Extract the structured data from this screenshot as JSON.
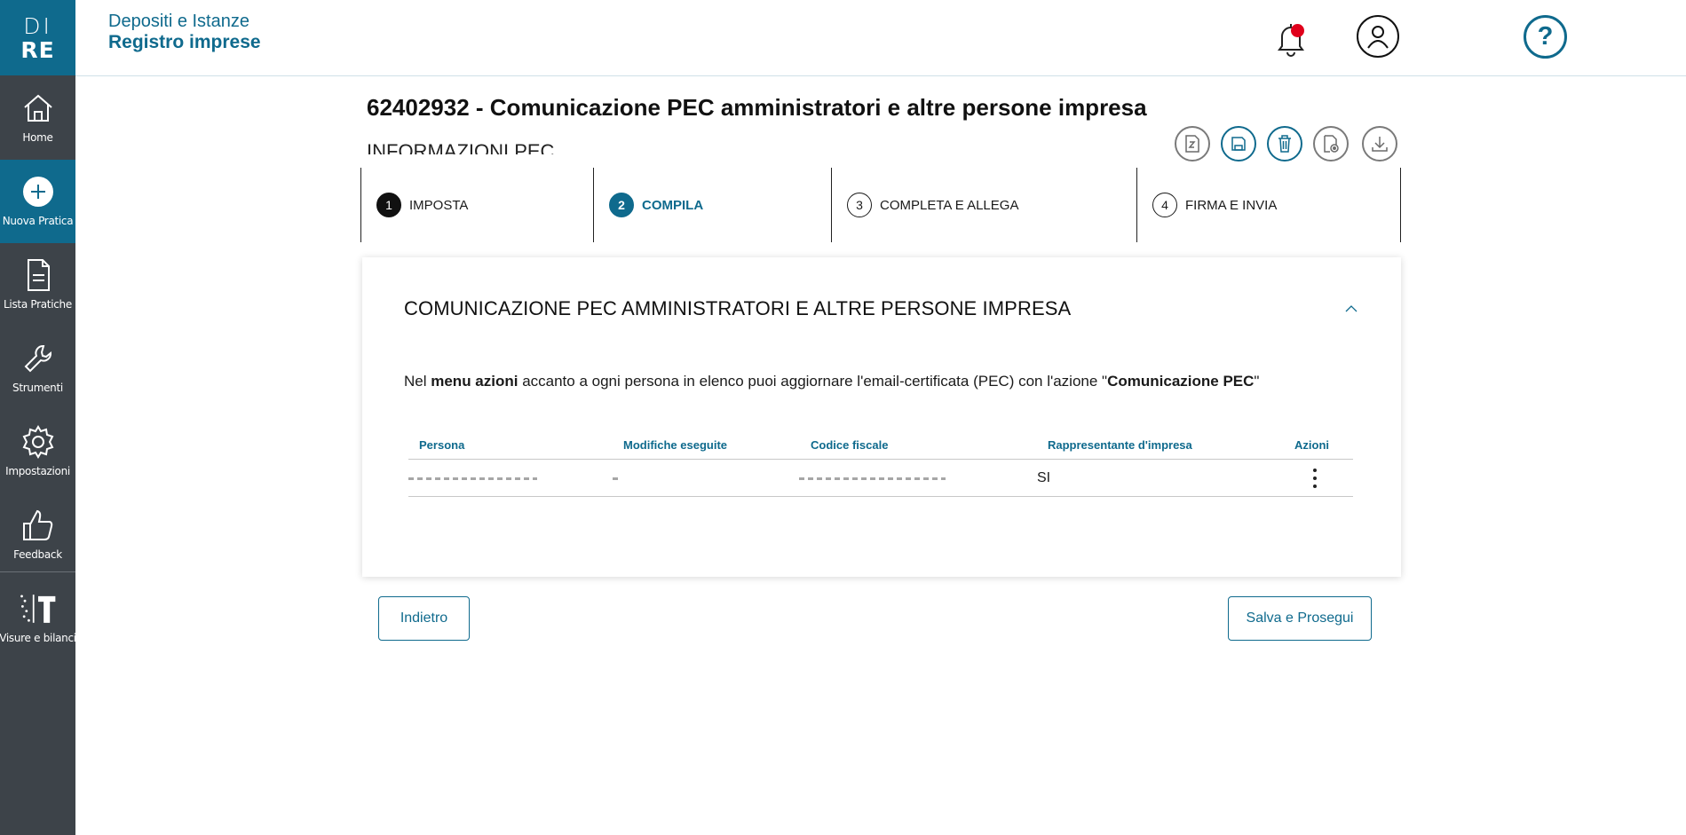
{
  "logo": {
    "line1": "DI",
    "line2": "RE"
  },
  "sidebar": {
    "items": [
      {
        "label": "Home"
      },
      {
        "label": "Nuova Pratica"
      },
      {
        "label": "Lista Pratiche"
      },
      {
        "label": "Strumenti"
      },
      {
        "label": "Impostazioni"
      },
      {
        "label": "Feedback"
      },
      {
        "label": "Visure e bilanci"
      }
    ]
  },
  "header": {
    "subtitle": "Depositi e Istanze",
    "title": "Registro imprese",
    "help": "?",
    "notification_icon": "bell-icon",
    "user_icon": "user-icon"
  },
  "page": {
    "title": "62402932 - Comunicazione PEC amministratori e altre persone impresa",
    "obscured_text": "INFORMAZIONI PEC"
  },
  "steps": [
    {
      "number": "1",
      "label": "IMPOSTA"
    },
    {
      "number": "2",
      "label": "COMPILA"
    },
    {
      "number": "3",
      "label": "COMPLETA E ALLEGA"
    },
    {
      "number": "4",
      "label": "FIRMA E INVIA"
    }
  ],
  "card": {
    "title": "COMUNICAZIONE PEC AMMINISTRATORI E ALTRE PERSONE IMPRESA",
    "intro_prefix": "Nel ",
    "intro_bold": "menu azioni",
    "intro_middle": " accanto a ogni persona in elenco puoi aggiornare l'email-certificata (PEC) con l'azione \"",
    "intro_bold2": "Comunicazione PEC",
    "intro_suffix": "\""
  },
  "table": {
    "columns": [
      "Persona",
      "Modifiche eseguite",
      "Codice fiscale",
      "Rappresentante d'impresa",
      "Azioni"
    ],
    "rows": [
      {
        "persona": "",
        "modifiche": "",
        "codice_fiscale": "",
        "rappresentante": "SI"
      }
    ]
  },
  "buttons": {
    "back": "Indietro",
    "next": "Salva e Prosegui"
  }
}
